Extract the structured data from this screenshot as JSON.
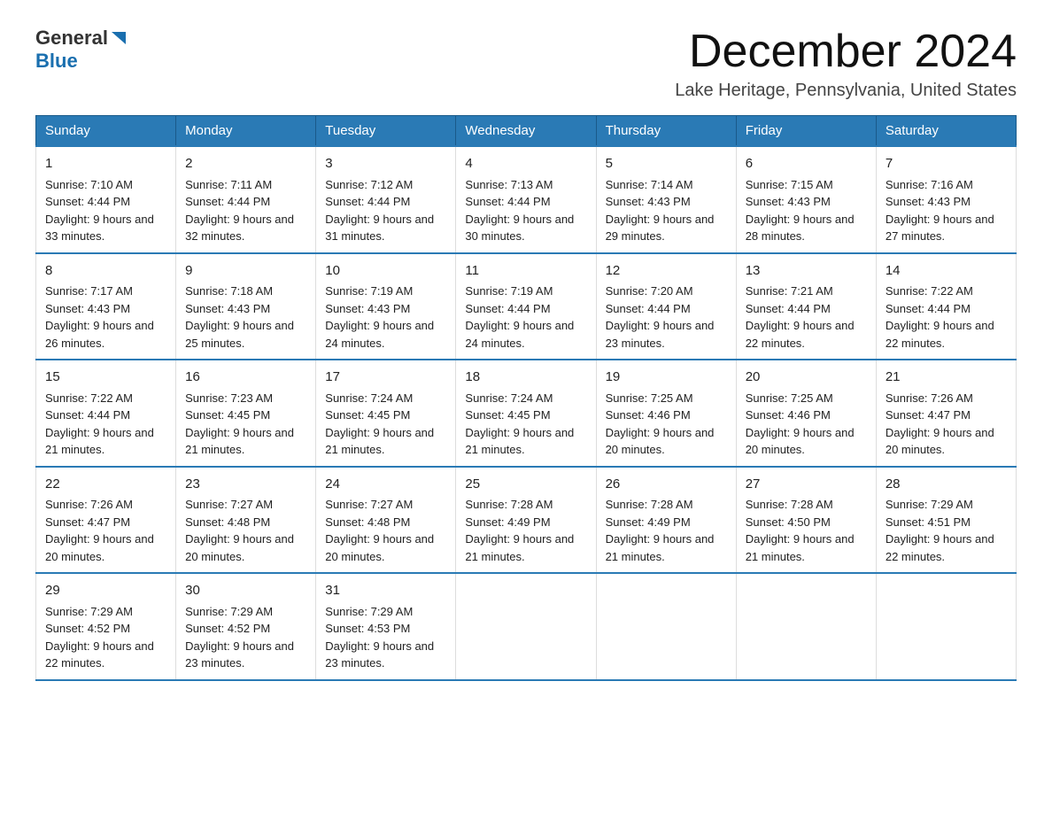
{
  "header": {
    "logo_general": "General",
    "logo_blue": "Blue",
    "month_title": "December 2024",
    "location": "Lake Heritage, Pennsylvania, United States"
  },
  "weekdays": [
    "Sunday",
    "Monday",
    "Tuesday",
    "Wednesday",
    "Thursday",
    "Friday",
    "Saturday"
  ],
  "weeks": [
    [
      {
        "day": "1",
        "sunrise": "7:10 AM",
        "sunset": "4:44 PM",
        "daylight": "9 hours and 33 minutes."
      },
      {
        "day": "2",
        "sunrise": "7:11 AM",
        "sunset": "4:44 PM",
        "daylight": "9 hours and 32 minutes."
      },
      {
        "day": "3",
        "sunrise": "7:12 AM",
        "sunset": "4:44 PM",
        "daylight": "9 hours and 31 minutes."
      },
      {
        "day": "4",
        "sunrise": "7:13 AM",
        "sunset": "4:44 PM",
        "daylight": "9 hours and 30 minutes."
      },
      {
        "day": "5",
        "sunrise": "7:14 AM",
        "sunset": "4:43 PM",
        "daylight": "9 hours and 29 minutes."
      },
      {
        "day": "6",
        "sunrise": "7:15 AM",
        "sunset": "4:43 PM",
        "daylight": "9 hours and 28 minutes."
      },
      {
        "day": "7",
        "sunrise": "7:16 AM",
        "sunset": "4:43 PM",
        "daylight": "9 hours and 27 minutes."
      }
    ],
    [
      {
        "day": "8",
        "sunrise": "7:17 AM",
        "sunset": "4:43 PM",
        "daylight": "9 hours and 26 minutes."
      },
      {
        "day": "9",
        "sunrise": "7:18 AM",
        "sunset": "4:43 PM",
        "daylight": "9 hours and 25 minutes."
      },
      {
        "day": "10",
        "sunrise": "7:19 AM",
        "sunset": "4:43 PM",
        "daylight": "9 hours and 24 minutes."
      },
      {
        "day": "11",
        "sunrise": "7:19 AM",
        "sunset": "4:44 PM",
        "daylight": "9 hours and 24 minutes."
      },
      {
        "day": "12",
        "sunrise": "7:20 AM",
        "sunset": "4:44 PM",
        "daylight": "9 hours and 23 minutes."
      },
      {
        "day": "13",
        "sunrise": "7:21 AM",
        "sunset": "4:44 PM",
        "daylight": "9 hours and 22 minutes."
      },
      {
        "day": "14",
        "sunrise": "7:22 AM",
        "sunset": "4:44 PM",
        "daylight": "9 hours and 22 minutes."
      }
    ],
    [
      {
        "day": "15",
        "sunrise": "7:22 AM",
        "sunset": "4:44 PM",
        "daylight": "9 hours and 21 minutes."
      },
      {
        "day": "16",
        "sunrise": "7:23 AM",
        "sunset": "4:45 PM",
        "daylight": "9 hours and 21 minutes."
      },
      {
        "day": "17",
        "sunrise": "7:24 AM",
        "sunset": "4:45 PM",
        "daylight": "9 hours and 21 minutes."
      },
      {
        "day": "18",
        "sunrise": "7:24 AM",
        "sunset": "4:45 PM",
        "daylight": "9 hours and 21 minutes."
      },
      {
        "day": "19",
        "sunrise": "7:25 AM",
        "sunset": "4:46 PM",
        "daylight": "9 hours and 20 minutes."
      },
      {
        "day": "20",
        "sunrise": "7:25 AM",
        "sunset": "4:46 PM",
        "daylight": "9 hours and 20 minutes."
      },
      {
        "day": "21",
        "sunrise": "7:26 AM",
        "sunset": "4:47 PM",
        "daylight": "9 hours and 20 minutes."
      }
    ],
    [
      {
        "day": "22",
        "sunrise": "7:26 AM",
        "sunset": "4:47 PM",
        "daylight": "9 hours and 20 minutes."
      },
      {
        "day": "23",
        "sunrise": "7:27 AM",
        "sunset": "4:48 PM",
        "daylight": "9 hours and 20 minutes."
      },
      {
        "day": "24",
        "sunrise": "7:27 AM",
        "sunset": "4:48 PM",
        "daylight": "9 hours and 20 minutes."
      },
      {
        "day": "25",
        "sunrise": "7:28 AM",
        "sunset": "4:49 PM",
        "daylight": "9 hours and 21 minutes."
      },
      {
        "day": "26",
        "sunrise": "7:28 AM",
        "sunset": "4:49 PM",
        "daylight": "9 hours and 21 minutes."
      },
      {
        "day": "27",
        "sunrise": "7:28 AM",
        "sunset": "4:50 PM",
        "daylight": "9 hours and 21 minutes."
      },
      {
        "day": "28",
        "sunrise": "7:29 AM",
        "sunset": "4:51 PM",
        "daylight": "9 hours and 22 minutes."
      }
    ],
    [
      {
        "day": "29",
        "sunrise": "7:29 AM",
        "sunset": "4:52 PM",
        "daylight": "9 hours and 22 minutes."
      },
      {
        "day": "30",
        "sunrise": "7:29 AM",
        "sunset": "4:52 PM",
        "daylight": "9 hours and 23 minutes."
      },
      {
        "day": "31",
        "sunrise": "7:29 AM",
        "sunset": "4:53 PM",
        "daylight": "9 hours and 23 minutes."
      },
      null,
      null,
      null,
      null
    ]
  ],
  "labels": {
    "sunrise": "Sunrise:",
    "sunset": "Sunset:",
    "daylight": "Daylight:"
  }
}
